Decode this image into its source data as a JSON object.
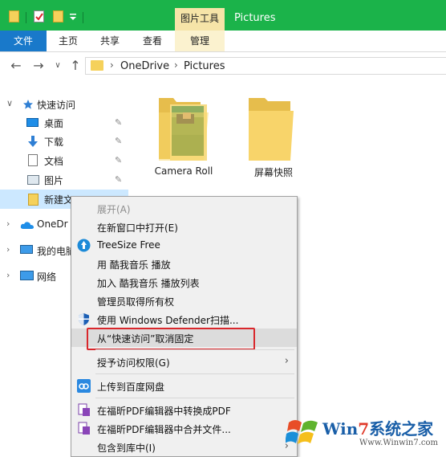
{
  "titlebar": {
    "contextual_tab": "图片工具",
    "title": "Pictures"
  },
  "ribbon": {
    "tabs": [
      "文件",
      "主页",
      "共享",
      "查看",
      "管理"
    ]
  },
  "address": {
    "breadcrumb": [
      "OneDrive",
      "Pictures"
    ]
  },
  "nav": {
    "quick_access": "快速访问",
    "items": [
      "桌面",
      "下载",
      "文档",
      "图片",
      "新建文"
    ],
    "onedrive": "OneDr",
    "this_pc": "我的电脑",
    "network": "网络"
  },
  "content": {
    "folders": [
      "Camera Roll",
      "屏幕快照"
    ]
  },
  "context_menu": {
    "items": [
      "展开(A)",
      "在新窗口中打开(E)",
      "TreeSize Free",
      "用 酷我音乐 播放",
      "加入 酷我音乐 播放列表",
      "管理员取得所有权",
      "使用 Windows Defender扫描...",
      "从“快速访问”取消固定",
      "授予访问权限(G)",
      "上传到百度网盘",
      "在福昕PDF编辑器中转换成PDF",
      "在福昕PDF编辑器中合并文件...",
      "包含到库中(I)"
    ]
  },
  "watermark": {
    "brand_part1": "Win",
    "brand_digit": "7",
    "brand_part2": "系统之家",
    "url": "Www.Winwin7.com"
  },
  "colors": {
    "titlebar": "#1bb34a",
    "file_tab": "#1979ca",
    "contextual_tab": "#f6e4a8",
    "highlight_box": "#d9272c"
  }
}
